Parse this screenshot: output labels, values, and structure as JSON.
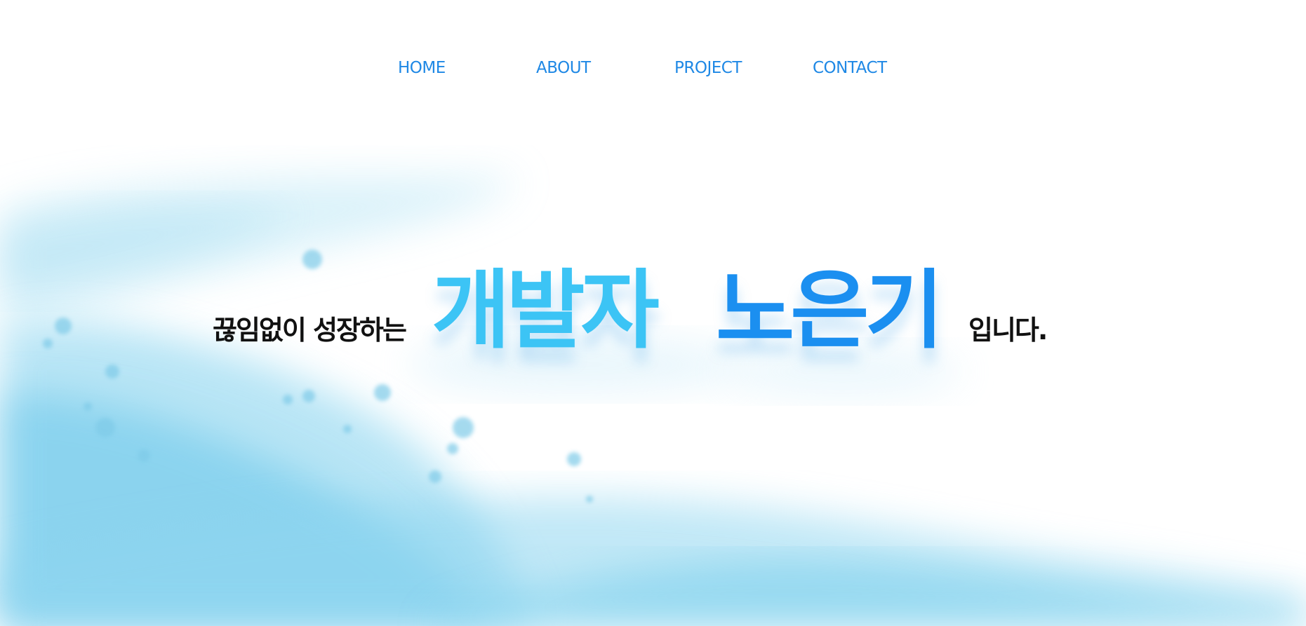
{
  "nav": {
    "items": [
      {
        "label": "HOME"
      },
      {
        "label": "ABOUT"
      },
      {
        "label": "PROJECT"
      },
      {
        "label": "CONTACT"
      }
    ]
  },
  "hero": {
    "prefix": "끊임없이 성장하는",
    "name_first": "개발자",
    "name_second": "노은기",
    "suffix": "입니다."
  },
  "colors": {
    "nav_text": "#1e88e5",
    "name_first": "#3cc4f5",
    "name_second": "#1b8ff0",
    "body_text": "#111111",
    "wash": "#5ec6e8"
  }
}
